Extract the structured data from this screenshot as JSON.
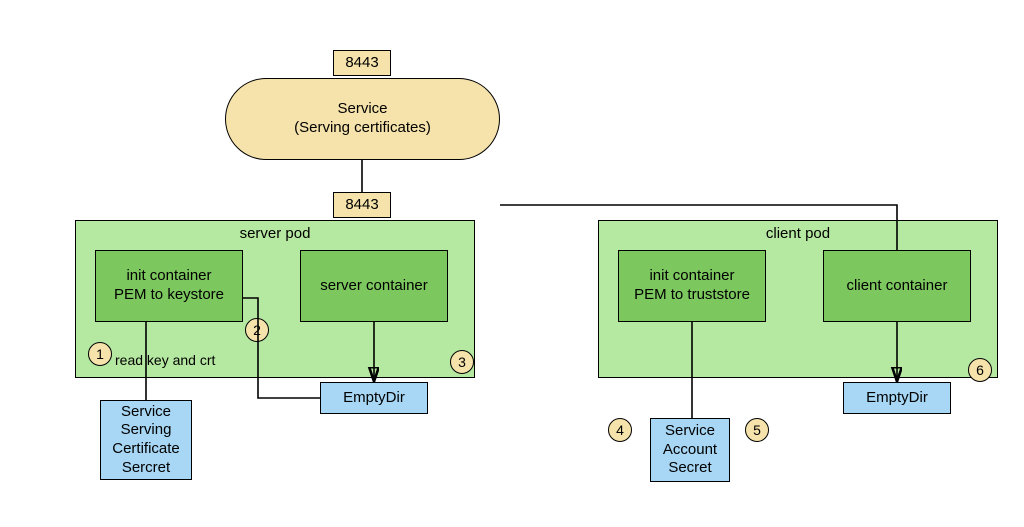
{
  "service": {
    "title": "Service\n(Serving certificates)",
    "port_top": "8443",
    "port_bottom": "8443"
  },
  "server_pod": {
    "title": "server pod",
    "init_container": "init container\nPEM to keystore",
    "server_container": "server container",
    "emptydir": "EmptyDir",
    "secret": "Service\nServing\nCertificate\nSercret",
    "label_read": "read key and crt"
  },
  "client_pod": {
    "title": "client pod",
    "init_container": "init container\nPEM to truststore",
    "client_container": "client container",
    "emptydir": "EmptyDir",
    "secret": "Service\nAccount\nSecret"
  },
  "numbers": {
    "n1": "1",
    "n2": "2",
    "n3": "3",
    "n4": "4",
    "n5": "5",
    "n6": "6"
  }
}
